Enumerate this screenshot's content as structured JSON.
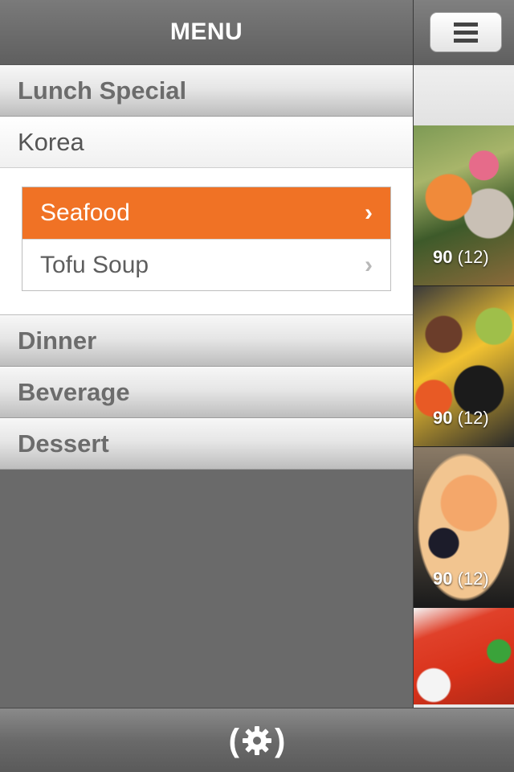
{
  "header": {
    "title": "MENU"
  },
  "menu": {
    "sections": [
      {
        "label": "Lunch Special"
      },
      {
        "label": "Dinner"
      },
      {
        "label": "Beverage"
      },
      {
        "label": "Dessert"
      }
    ],
    "lunch_sub": {
      "label": "Korea"
    },
    "items": [
      {
        "label": "Seafood",
        "active": true
      },
      {
        "label": "Tofu Soup",
        "active": false
      }
    ]
  },
  "preview": {
    "thumbs": [
      {
        "score": "90",
        "count": "(12)",
        "icon": "seafood-photo"
      },
      {
        "score": "90",
        "count": "(12)",
        "icon": "bibimbap-photo"
      },
      {
        "score": "90",
        "count": "(12)",
        "icon": "tofu-soup-photo"
      },
      {
        "icon": "spicy-dish-photo"
      }
    ]
  },
  "colors": {
    "accent": "#f07225",
    "panel": "#6a6a6a"
  },
  "footer": {
    "settings_icon": "gear-icon",
    "paren_left": "(",
    "paren_right": ")"
  }
}
